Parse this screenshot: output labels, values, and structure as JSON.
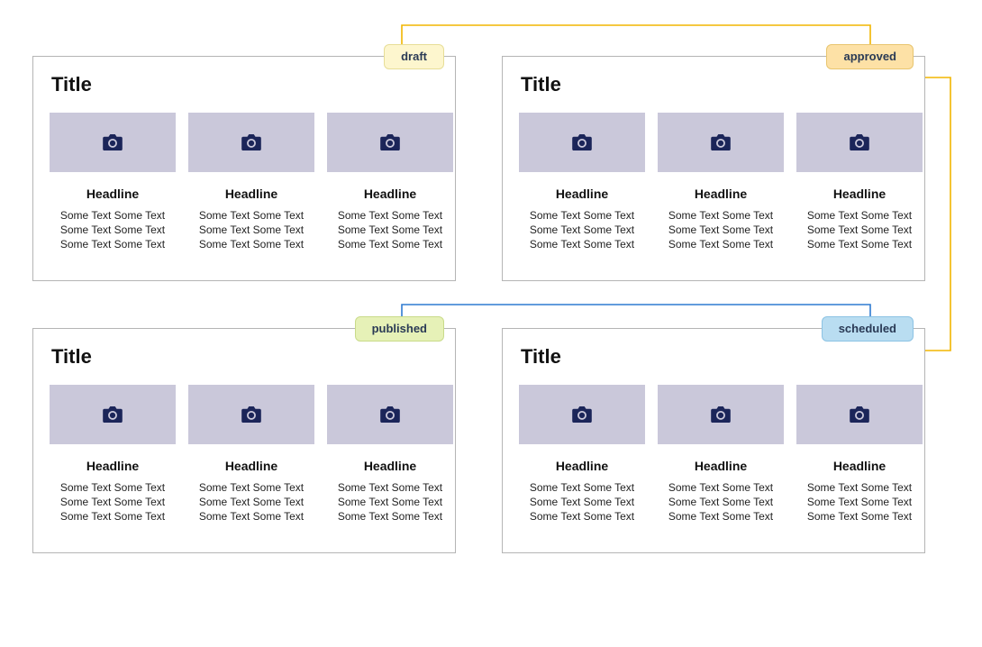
{
  "badge_colors": {
    "draft": "#fdf6ce",
    "approved": "#fde1a6",
    "published": "#e6f1b7",
    "scheduled": "#b9ddf1"
  },
  "arrow_colors": {
    "amber": "#f2b500",
    "blue": "#2f7bd1"
  },
  "panels": [
    {
      "id": "draft",
      "badge": "draft",
      "badge_class": "yellow-soft",
      "title": "Title",
      "cards": [
        {
          "headline": "Headline",
          "lines": [
            "Some Text Some Text",
            "Some Text Some Text",
            "Some Text Some Text"
          ]
        },
        {
          "headline": "Headline",
          "lines": [
            "Some Text Some Text",
            "Some Text Some Text",
            "Some Text Some Text"
          ]
        },
        {
          "headline": "Headline",
          "lines": [
            "Some Text Some Text",
            "Some Text Some Text",
            "Some Text Some Text"
          ]
        }
      ]
    },
    {
      "id": "approved",
      "badge": "approved",
      "badge_class": "amber",
      "title": "Title",
      "cards": [
        {
          "headline": "Headline",
          "lines": [
            "Some Text Some Text",
            "Some Text Some Text",
            "Some Text Some Text"
          ]
        },
        {
          "headline": "Headline",
          "lines": [
            "Some Text Some Text",
            "Some Text Some Text",
            "Some Text Some Text"
          ]
        },
        {
          "headline": "Headline",
          "lines": [
            "Some Text Some Text",
            "Some Text Some Text",
            "Some Text Some Text"
          ]
        }
      ]
    },
    {
      "id": "published",
      "badge": "published",
      "badge_class": "green-soft",
      "title": "Title",
      "cards": [
        {
          "headline": "Headline",
          "lines": [
            "Some Text Some Text",
            "Some Text Some Text",
            "Some Text Some Text"
          ]
        },
        {
          "headline": "Headline",
          "lines": [
            "Some Text Some Text",
            "Some Text Some Text",
            "Some Text Some Text"
          ]
        },
        {
          "headline": "Headline",
          "lines": [
            "Some Text Some Text",
            "Some Text Some Text",
            "Some Text Some Text"
          ]
        }
      ]
    },
    {
      "id": "scheduled",
      "badge": "scheduled",
      "badge_class": "blue-soft",
      "title": "Title",
      "cards": [
        {
          "headline": "Headline",
          "lines": [
            "Some Text Some Text",
            "Some Text Some Text",
            "Some Text Some Text"
          ]
        },
        {
          "headline": "Headline",
          "lines": [
            "Some Text Some Text",
            "Some Text Some Text",
            "Some Text Some Text"
          ]
        },
        {
          "headline": "Headline",
          "lines": [
            "Some Text Some Text",
            "Some Text Some Text",
            "Some Text Some Text"
          ]
        }
      ]
    }
  ]
}
